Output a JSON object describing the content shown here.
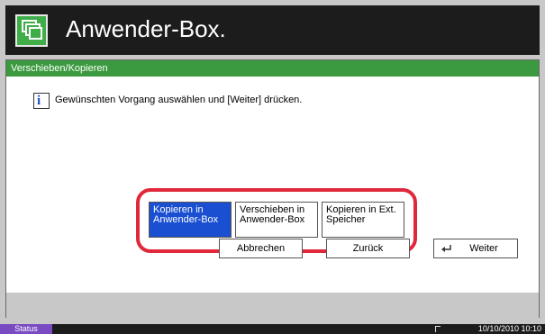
{
  "header": {
    "title": "Anwender-Box.",
    "icon": "boxes-icon"
  },
  "panel": {
    "tab_label": "Verschieben/Kopieren",
    "instruction": "Gewünschten Vorgang auswählen und [Weiter] drücken.",
    "info_icon": "i",
    "options": [
      {
        "label": "Kopieren in Anwender-Box",
        "selected": true
      },
      {
        "label": "Verschieben in Anwender-Box",
        "selected": false
      },
      {
        "label": "Kopieren in Ext. Speicher",
        "selected": false
      }
    ]
  },
  "footer": {
    "cancel_label": "Abbrechen",
    "back_label": "Zurück",
    "next_label": "Weiter",
    "next_icon": "enter-arrow-icon"
  },
  "status_bar": {
    "label": "Status",
    "datetime": "10/10/2010  10:10"
  },
  "colors": {
    "accent": "#3b9a3f",
    "selected": "#1a4fd1",
    "highlight": "#e0283a",
    "status": "#7a4ac2"
  }
}
